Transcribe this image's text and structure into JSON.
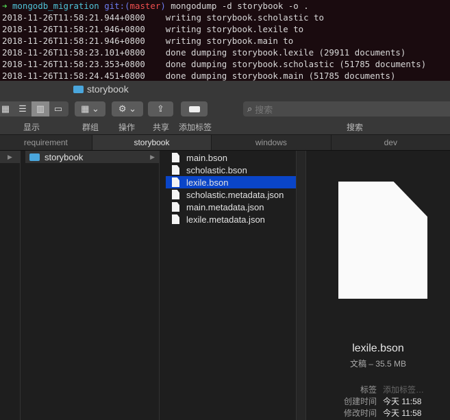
{
  "terminal": {
    "prompt": {
      "arrow": "➜",
      "dir": "mongodb_migration",
      "git_prefix": "git:(",
      "branch": "master",
      "git_suffix": ")",
      "command": "mongodump -d storybook -o ."
    },
    "lines": [
      {
        "ts": "2018-11-26T11:58:21.944+0800",
        "msg": "writing storybook.scholastic to"
      },
      {
        "ts": "2018-11-26T11:58:21.946+0800",
        "msg": "writing storybook.lexile to"
      },
      {
        "ts": "2018-11-26T11:58:21.946+0800",
        "msg": "writing storybook.main to"
      },
      {
        "ts": "2018-11-26T11:58:23.101+0800",
        "msg": "done dumping storybook.lexile (29911 documents)"
      },
      {
        "ts": "2018-11-26T11:58:23.353+0800",
        "msg": "done dumping storybook.scholastic (51785 documents)"
      },
      {
        "ts": "2018-11-26T11:58:24.451+0800",
        "msg": "done dumping storybook.main (51785 documents)"
      }
    ]
  },
  "finder": {
    "title": "storybook",
    "toolbar": {
      "view": "显示",
      "group": "群组",
      "action": "操作",
      "share": "共享",
      "tags": "添加标签",
      "search": "搜索",
      "search_placeholder": "搜索"
    },
    "tabs": [
      "requirement",
      "storybook",
      "windows",
      "dev"
    ],
    "folder": "storybook",
    "files": [
      "main.bson",
      "scholastic.bson",
      "lexile.bson",
      "scholastic.metadata.json",
      "main.metadata.json",
      "lexile.metadata.json"
    ],
    "selected_index": 2,
    "preview": {
      "name": "lexile.bson",
      "kind": "文稿 – 35.5 MB",
      "tags_label": "标签",
      "tags_value": "添加标签…",
      "created_label": "创建时间",
      "created": "今天 11:58",
      "modified_label": "修改时间",
      "modified": "今天 11:58"
    }
  }
}
